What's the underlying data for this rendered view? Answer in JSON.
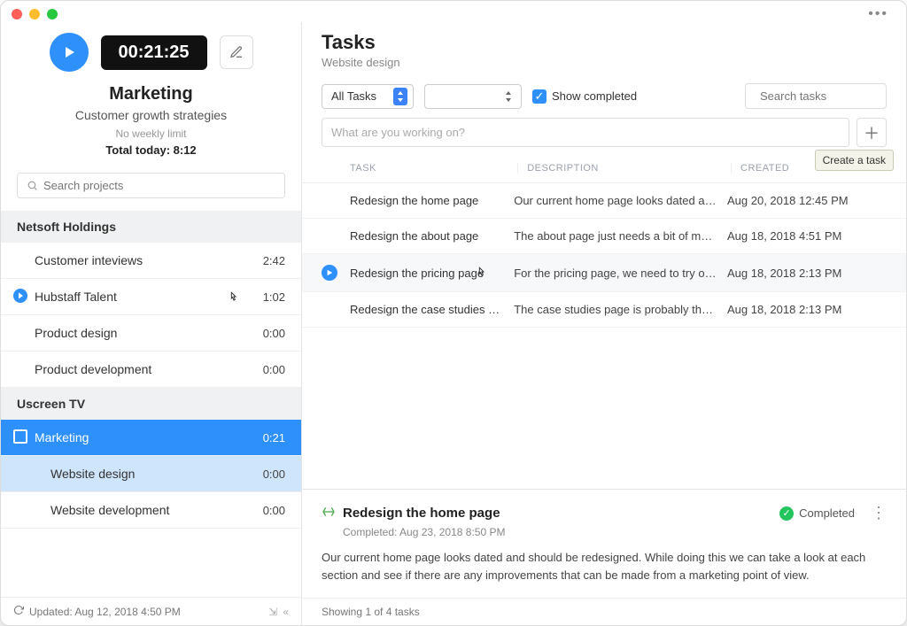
{
  "sidebar": {
    "timer": "00:21:25",
    "project_title": "Marketing",
    "project_subtitle": "Customer growth strategies",
    "weekly_limit": "No weekly limit",
    "total_today_label": "Total today: 8:12",
    "search_placeholder": "Search projects",
    "groups": [
      {
        "name": "Netsoft Holdings",
        "items": [
          {
            "name": "Customer inteviews",
            "time": "2:42",
            "tracking": false
          },
          {
            "name": "Hubstaff Talent",
            "time": "1:02",
            "tracking": true,
            "hover": true
          },
          {
            "name": "Product design",
            "time": "0:00",
            "tracking": false
          },
          {
            "name": "Product development",
            "time": "0:00",
            "tracking": false
          }
        ]
      },
      {
        "name": "Uscreen TV",
        "items": [
          {
            "name": "Marketing",
            "time": "0:21",
            "selected": true
          },
          {
            "name": "Website design",
            "time": "0:00",
            "sub": true,
            "highlight": true
          },
          {
            "name": "Website development",
            "time": "0:00",
            "sub": true
          }
        ]
      }
    ],
    "footer": "Updated: Aug 12, 2018 4:50 PM"
  },
  "main": {
    "title": "Tasks",
    "subtitle": "Website design",
    "filter_all_tasks": "All Tasks",
    "show_completed_label": "Show completed",
    "search_tasks_placeholder": "Search tasks",
    "working_placeholder": "What are you working on?",
    "create_task_tooltip": "Create a task",
    "columns": {
      "task": "TASK",
      "description": "DESCRIPTION",
      "created": "CREATED"
    },
    "rows": [
      {
        "name": "Redesign the home page",
        "desc": "Our current home page looks dated and should…",
        "created": "Aug 20, 2018 12:45 PM"
      },
      {
        "name": "Redesign the about page",
        "desc": "The about page just needs a bit of makeup, bec…",
        "created": "Aug 18, 2018 4:51 PM"
      },
      {
        "name": "Redesign the pricing page",
        "desc": "For the pricing page, we need to try out a differe…",
        "created": "Aug 18, 2018 2:13 PM",
        "hover": true
      },
      {
        "name": "Redesign the case studies pa…",
        "desc": "The case studies page is probably the one that …",
        "created": "Aug 18, 2018 2:13 PM"
      }
    ],
    "detail": {
      "title": "Redesign the home page",
      "completed_at": "Completed: Aug 23, 2018 8:50 PM",
      "status": "Completed",
      "description": "Our current home page looks dated and should be redesigned. While doing this we can take a look at each section and see if there are any improvements that can be made from a marketing point of view."
    },
    "footer": "Showing 1 of 4 tasks"
  }
}
